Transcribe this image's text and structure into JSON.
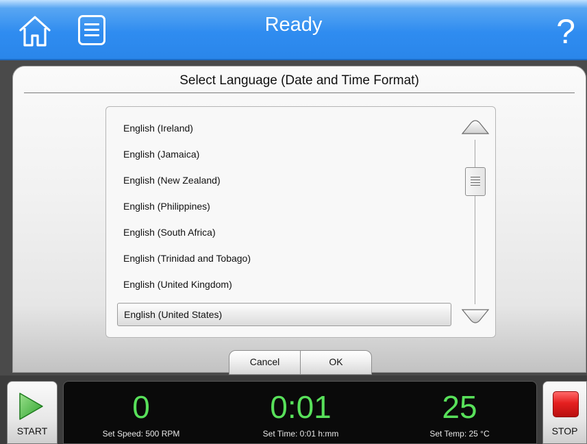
{
  "header": {
    "title": "Ready",
    "home_icon": "home-icon",
    "menu_icon": "list-menu-icon",
    "help_label": "?",
    "colors": {
      "bar": "#2f8cf0",
      "text": "#ffffff"
    }
  },
  "dialog": {
    "heading": "Select Language (Date and Time Format)",
    "items": [
      {
        "label": "English (Ireland)"
      },
      {
        "label": "English (Jamaica)"
      },
      {
        "label": "English (New Zealand)"
      },
      {
        "label": "English (Philippines)"
      },
      {
        "label": "English (South Africa)"
      },
      {
        "label": "English (Trinidad and Tobago)"
      },
      {
        "label": "English (United Kingdom)"
      },
      {
        "label": "English (United States)"
      }
    ],
    "selected_label": "English (United States)",
    "cancel_label": "Cancel",
    "ok_label": "OK"
  },
  "footer": {
    "start_label": "START",
    "stop_label": "STOP",
    "speed": {
      "value": "0",
      "set": "Set Speed: 500 RPM"
    },
    "time": {
      "value": "0:01",
      "set": "Set Time: 0:01 h:mm"
    },
    "temp": {
      "value": "25",
      "set": "Set Temp: 25 °C"
    },
    "colors": {
      "readout": "#58e05a",
      "stop": "#e52020",
      "start": "#3bb83b"
    }
  }
}
